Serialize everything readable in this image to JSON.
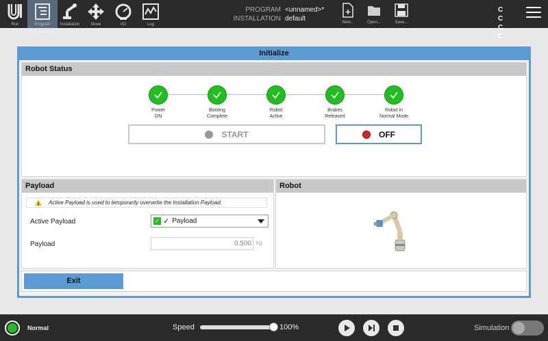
{
  "topbar": {
    "nav": [
      {
        "label": "Run",
        "icon": "ur-logo-icon"
      },
      {
        "label": "Program",
        "icon": "program-icon",
        "active": true
      },
      {
        "label": "Installation",
        "icon": "robot-arm-icon"
      },
      {
        "label": "Move",
        "icon": "move-arrows-icon"
      },
      {
        "label": "I/O",
        "icon": "io-gauge-icon"
      },
      {
        "label": "Log",
        "icon": "log-chart-icon"
      }
    ],
    "program_key": "PROGRAM",
    "program_value": "<unnamed>*",
    "installation_key": "INSTALLATION",
    "installation_value": "default",
    "file": [
      {
        "label": "New...",
        "icon": "new-file-icon"
      },
      {
        "label": "Open...",
        "icon": "folder-icon"
      },
      {
        "label": "Save...",
        "icon": "save-icon"
      }
    ],
    "cc_top": "C C",
    "cc_bottom": "C C"
  },
  "dialog": {
    "title": "Initialize",
    "robot_status": {
      "heading": "Robot Status",
      "steps": [
        {
          "line1": "Power",
          "line2": "ON"
        },
        {
          "line1": "Booting",
          "line2": "Complete"
        },
        {
          "line1": "Robot",
          "line2": "Active"
        },
        {
          "line1": "Brakes",
          "line2": "Released"
        },
        {
          "line1": "Robot in",
          "line2": "Normal Mode"
        }
      ],
      "start_label": "START",
      "off_label": "OFF"
    },
    "payload": {
      "heading": "Payload",
      "note": "Active Payload is used to temporarily overwrite the Installation Payload.",
      "active_payload_label": "Active Payload",
      "active_payload_value": "Payload",
      "payload_label": "Payload",
      "payload_value": "0.500",
      "payload_unit": "kg"
    },
    "robot": {
      "heading": "Robot"
    },
    "exit_label": "Exit"
  },
  "bottombar": {
    "status": "Normal",
    "speed_label": "Speed",
    "speed_value": "100%",
    "speed_fraction": 1.0,
    "simulation_label": "Simulation"
  },
  "colors": {
    "accent": "#5a9bd5",
    "ok_green": "#1fbf1f",
    "off_red": "#e02020",
    "bar_dark": "#2a2a2a"
  }
}
